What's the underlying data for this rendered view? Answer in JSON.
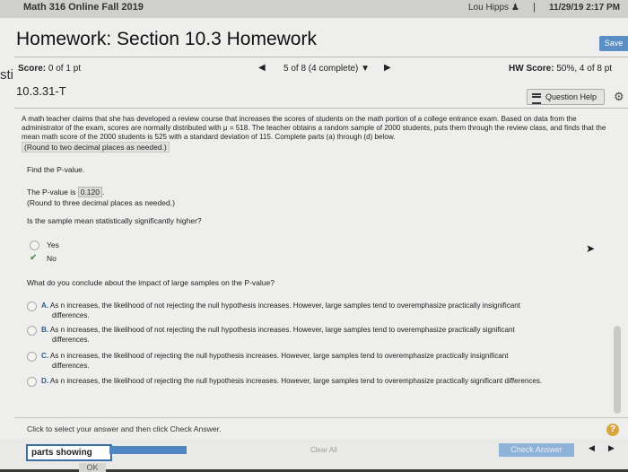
{
  "header": {
    "course": "Math 316 Online Fall 2019",
    "user": "Lou Hipps",
    "separator": "|",
    "datetime": "11/29/19 2:17 PM"
  },
  "title": "Homework: Section 10.3 Homework",
  "save_label": "Save",
  "left_edge_text": "sti",
  "score": {
    "label": "Score:",
    "value": "0 of 1 pt"
  },
  "navigation": {
    "prev": "◀",
    "status": "5 of 8 (4 complete)",
    "dropdown": "▼",
    "next": "▶"
  },
  "hw_score": {
    "label": "HW Score:",
    "value": "50%, 4 of 8 pt"
  },
  "question_id": "10.3.31-T",
  "question_help": "Question Help",
  "problem": {
    "text": "A math teacher claims that she has developed a review course that increases the scores of students on the math portion of a college entrance exam. Based on data from the administrator of the exam, scores are normally distributed with μ = 518. The teacher obtains a random sample of 2000 students, puts them through the review class, and finds that the mean math score of the 2000 students is 525 with a standard deviation of 115. Complete parts (a) through (d) below.",
    "round_note": "(Round to two decimal places as needed.)"
  },
  "part": {
    "find": "Find the P-value.",
    "pvalue_prefix": "The P-value is",
    "pvalue": "0.120",
    "round_note": "(Round to three decimal places as needed.)",
    "question": "Is the sample mean statistically significantly higher?",
    "yes": "Yes",
    "no": "No",
    "no_selected": true,
    "conclude": "What do you conclude about the impact of large samples on the P-value?",
    "options": [
      {
        "letter": "A.",
        "line1": "As n increases, the likelihood of not rejecting the null hypothesis increases. However, large samples tend to overemphasize practically insignificant",
        "line2": "differences."
      },
      {
        "letter": "B.",
        "line1": "As n increases, the likelihood of not rejecting the null hypothesis increases. However, large samples tend to overemphasize practically significant",
        "line2": "differences."
      },
      {
        "letter": "C.",
        "line1": "As n increases, the likelihood of rejecting the null hypothesis increases. However, large samples tend to overemphasize practically insignificant",
        "line2": "differences."
      },
      {
        "letter": "D.",
        "line1": "As n increases, the likelihood of rejecting the null hypothesis increases. However, large samples tend to overemphasize practically significant differences.",
        "line2": ""
      }
    ]
  },
  "footer": {
    "hint": "Click to select your answer and then click Check Answer.",
    "help_symbol": "?",
    "parts_showing": "parts showing",
    "clear_all": "Clear All",
    "check_answer": "Check Answer",
    "ok": "OK",
    "prev": "◀",
    "next": "▶"
  },
  "colors": {
    "accent": "#5a8ec4",
    "progress": "#4f86bf",
    "help": "#d9a640"
  }
}
